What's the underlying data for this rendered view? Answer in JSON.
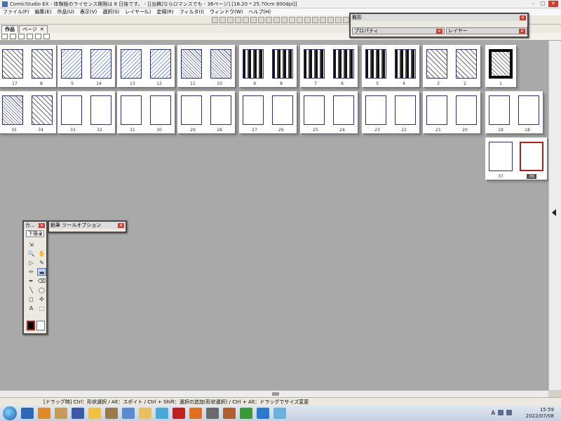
{
  "window": {
    "title": "ComicStudio EX - 体験版のライセンス期限は 8 日後です。 - [[出稿]ならロマンスでも - 36ページ] [18.20 * 25.70cm 600dpi]]",
    "controls": [
      "–",
      "□",
      "✕"
    ]
  },
  "menu": [
    "ファイル(F)",
    "編集(E)",
    "作品(U)",
    "表示(V)",
    "選択(S)",
    "レイヤー(L)",
    "定規(R)",
    "フィルタ(I)",
    "ウィンドウ(W)",
    "ヘルプ(H)"
  ],
  "tabs": [
    {
      "label": "作品",
      "active": true
    },
    {
      "label": "ページ",
      "active": false,
      "closable": "✕"
    }
  ],
  "navigator_panel": {
    "title": "概形",
    "left_tab": "プロパティ",
    "right_tab": "レイヤー",
    "close": "✕"
  },
  "tool_panel": {
    "title": "カ...",
    "close": "✕",
    "dropdown": "下描き",
    "tools": [
      "⇲",
      "🔍",
      "✋",
      "▷",
      "✎",
      "✏",
      "▬",
      "✒",
      "⌫",
      "╲",
      "◯",
      "◻",
      "✣",
      "A",
      "⬚",
      "⤢"
    ],
    "option_title": "鉛筆 ツールオプション",
    "option_close": "✕"
  },
  "pages": {
    "row1": [
      {
        "left": "17",
        "right": "8",
        "style": "hatch"
      },
      {
        "left": "5",
        "right": "14",
        "style": "blue"
      },
      {
        "left": "13",
        "right": "12",
        "style": "blue"
      },
      {
        "left": "11",
        "right": "10",
        "style": "mix"
      },
      {
        "left": "9",
        "right": "8",
        "style": "dark"
      },
      {
        "left": "7",
        "right": "6",
        "style": "dark"
      },
      {
        "left": "5",
        "right": "4",
        "style": "dark"
      },
      {
        "left": "3",
        "right": "2",
        "style": "hatch"
      }
    ],
    "row1_single": {
      "num": "1"
    },
    "row2": [
      {
        "left": "35",
        "right": "34",
        "style": "mix"
      },
      {
        "left": "33",
        "right": "32",
        "style": "blank"
      },
      {
        "left": "31",
        "right": "30",
        "style": "blank"
      },
      {
        "left": "29",
        "right": "28",
        "style": "blank"
      },
      {
        "left": "27",
        "right": "26",
        "style": "blank"
      },
      {
        "left": "25",
        "right": "24",
        "style": "blank"
      },
      {
        "left": "23",
        "right": "22",
        "style": "blank"
      },
      {
        "left": "21",
        "right": "20",
        "style": "blank"
      },
      {
        "left": "19",
        "right": "18",
        "style": "blank"
      }
    ],
    "row3": [
      {
        "num": "37",
        "selected": false
      },
      {
        "num": "36",
        "selected": true
      }
    ]
  },
  "status": "[ドラッグ時] Ctrl：形状選択 / Alt：スポイト / Ctrl + Shift：選択の追加(形状選択) / Ctrl + Alt：ドラッグでサイズ変更",
  "taskbar": {
    "apps": [
      "#2b69b8",
      "#e08a2a",
      "#c89a5a",
      "#3a5aa8",
      "#f0c040",
      "#9a7a4a",
      "#5a8ad0",
      "#e8c060",
      "#4aa8d8",
      "#c02020",
      "#e07020",
      "#6a6a6a",
      "#b06030",
      "#3a9a3a",
      "#2a7ad0",
      "#6ab0e0"
    ],
    "clock": "15:59",
    "date": "2022/07/08",
    "lang": "A"
  }
}
